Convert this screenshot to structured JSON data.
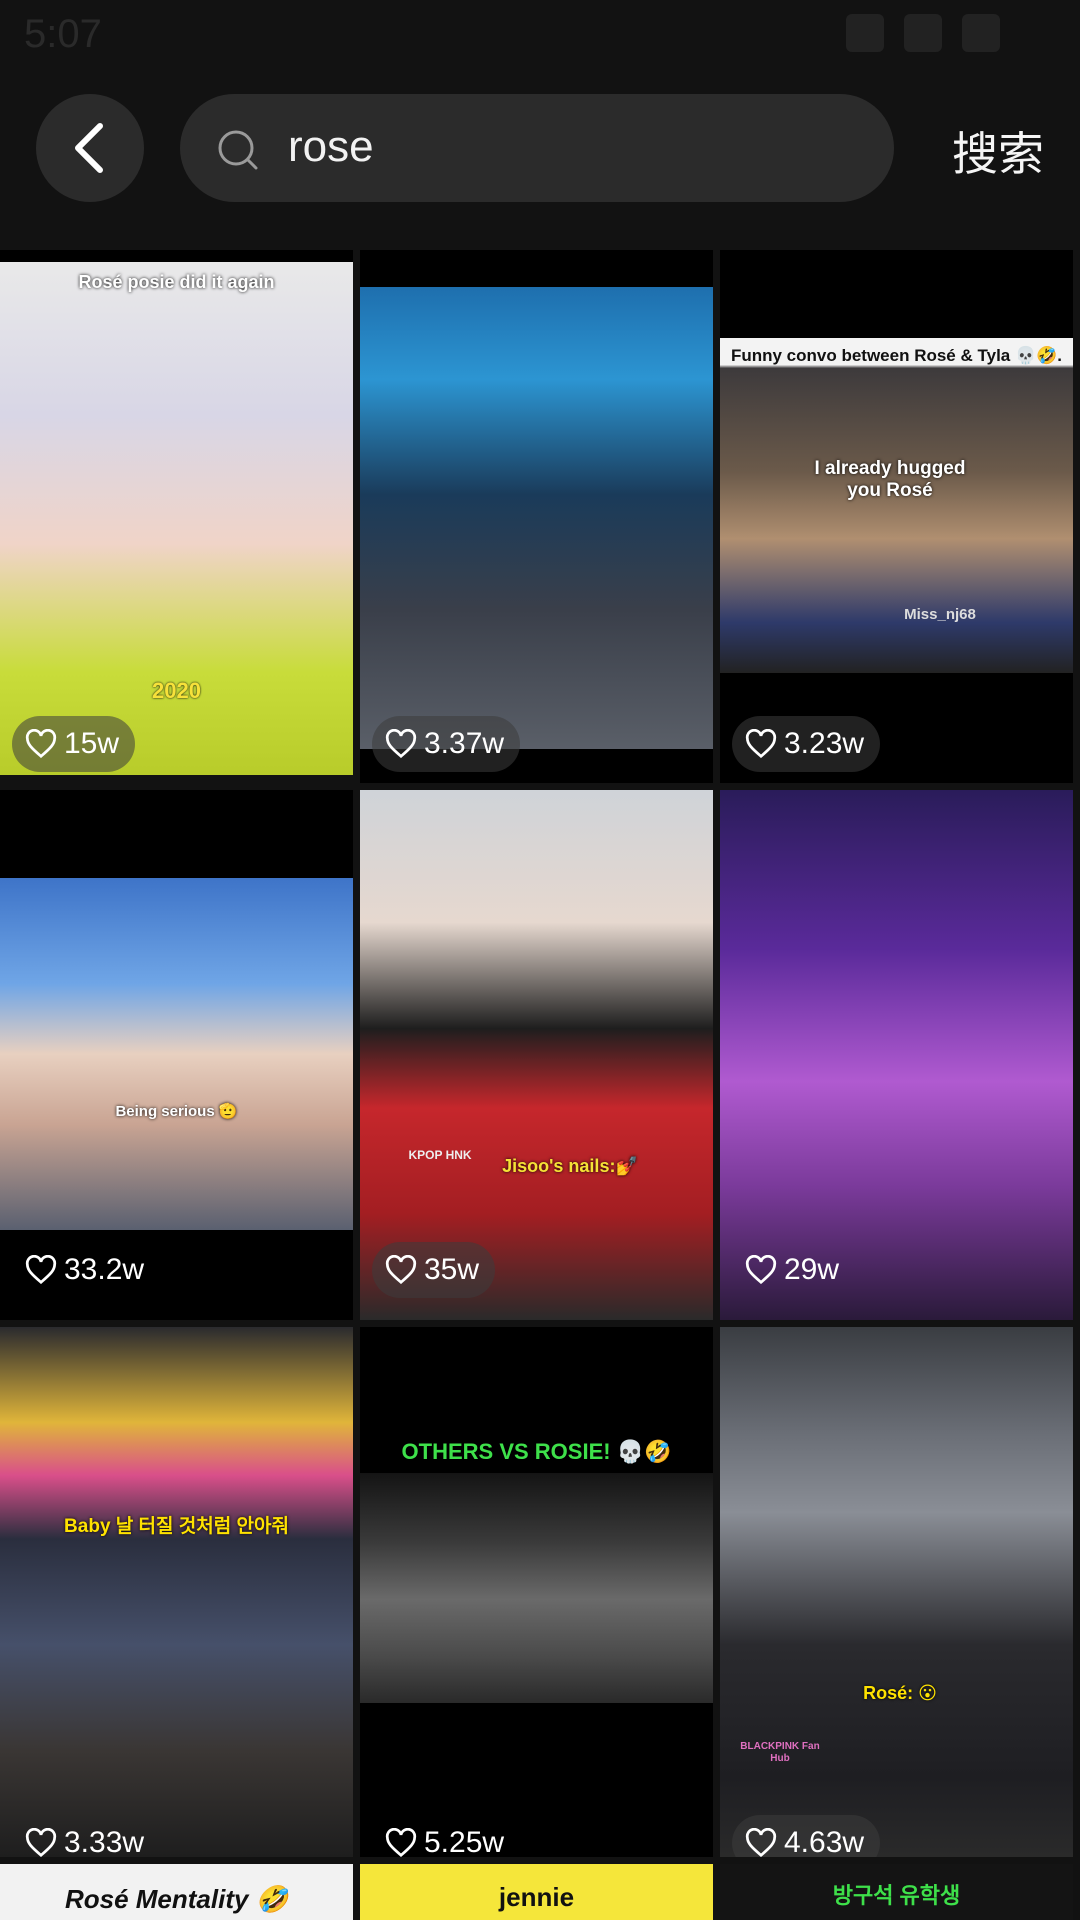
{
  "status": {
    "time": "5:07"
  },
  "search": {
    "query": "rose",
    "submit_label": "搜索"
  },
  "results": [
    {
      "likes": "15w",
      "caption": "Rosé posie did it again",
      "caption2": "2020"
    },
    {
      "likes": "3.37w"
    },
    {
      "likes": "3.23w",
      "caption": "Funny convo between Rosé & Tyla 💀🤣.",
      "caption2": "I already hugged you Rosé",
      "watermark": "Miss_nj68"
    },
    {
      "likes": "33.2w",
      "caption": "Being serious 🫡"
    },
    {
      "likes": "35w",
      "caption": "Jisoo's nails:💅",
      "watermark": "KPOP HNK"
    },
    {
      "likes": "29w"
    },
    {
      "likes": "3.33w",
      "caption": "Baby 날 터질 것처럼 안아줘"
    },
    {
      "likes": "5.25w",
      "caption": "OTHERS VS ROSIE! 💀🤣"
    },
    {
      "likes": "4.63w",
      "caption": "Rosé: 😮",
      "watermark": "BLACKPINK Fan Hub"
    }
  ],
  "partial_row": [
    {
      "caption": "Rosé Mentality 🤣"
    },
    {
      "caption": "jennie"
    },
    {
      "caption": "방구석 유학생"
    }
  ]
}
